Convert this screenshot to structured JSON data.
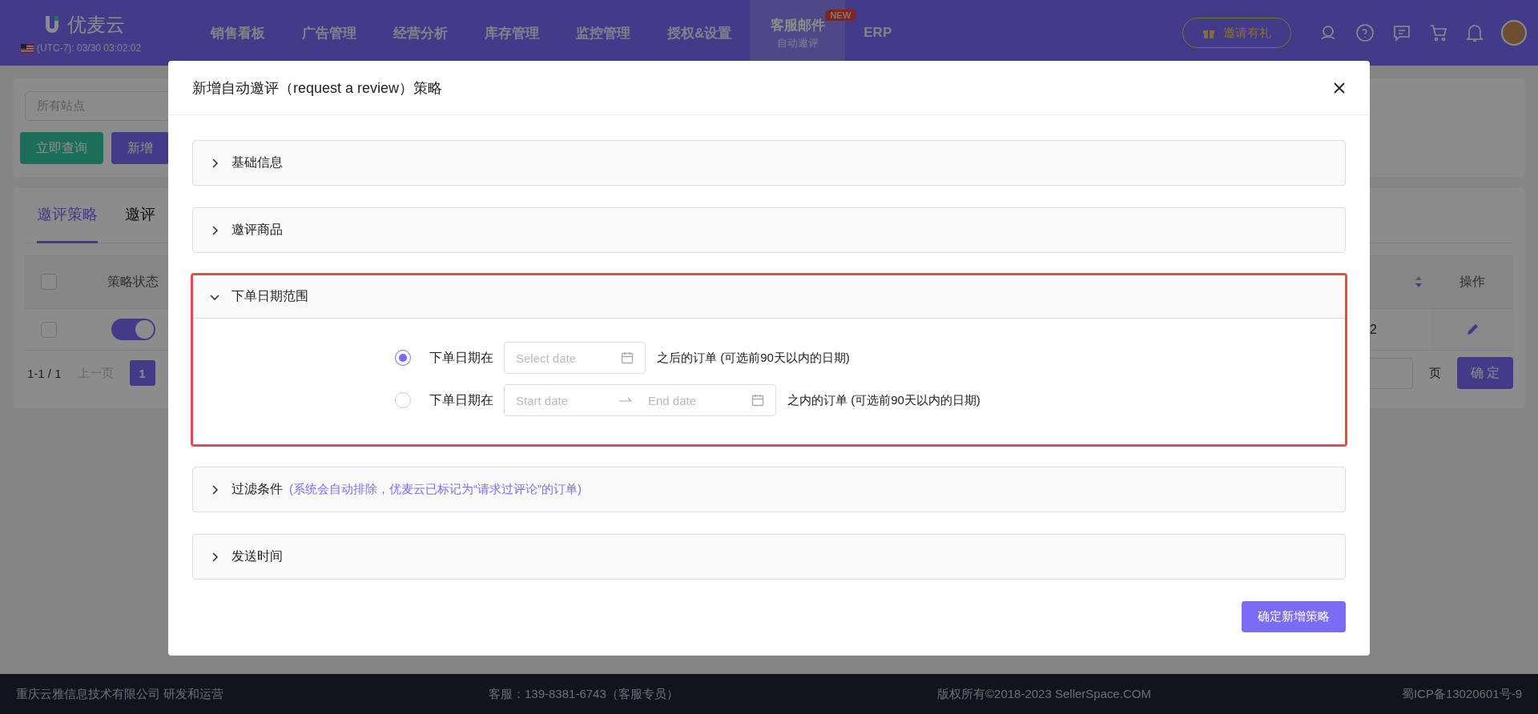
{
  "header": {
    "logo": "优麦云",
    "clock": "(UTC-7): 03/30 03:02:02",
    "nav": [
      {
        "label": "销售看板",
        "selected": false
      },
      {
        "label": "广告管理",
        "selected": false
      },
      {
        "label": "经营分析",
        "selected": false
      },
      {
        "label": "库存管理",
        "selected": false
      },
      {
        "label": "监控管理",
        "selected": false
      },
      {
        "label": "授权&设置",
        "selected": false
      },
      {
        "label": "客服邮件",
        "selected": true,
        "subtitle": "自动邀评",
        "badge": "NEW"
      },
      {
        "label": "ERP",
        "selected": false
      }
    ],
    "invite_button": "邀请有礼"
  },
  "page": {
    "site_select": {
      "placeholder": "所有站点"
    },
    "buttons": [
      {
        "label": "立即查询",
        "kind": "query"
      },
      {
        "label": "新增",
        "kind": "add"
      }
    ],
    "tabs": [
      {
        "label": "邀评策略",
        "selected": true
      },
      {
        "label": "邀评",
        "selected": false
      }
    ],
    "table": {
      "columns": [
        "策略状态",
        "操作"
      ],
      "header_checked": false,
      "rows": [
        {
          "checked": false,
          "on": true,
          "column_4": "2"
        }
      ]
    },
    "pagination": {
      "range": "1-1 / 1",
      "prev": "上一页",
      "pages": [
        {
          "label": "1",
          "selected": true
        }
      ],
      "page_unit": "页",
      "go_button": "确 定"
    }
  },
  "modal": {
    "title": "新增自动邀评（request a review）策略",
    "panels": [
      {
        "title": "基础信息",
        "expanded": false,
        "highlighted": false
      },
      {
        "title": "邀评商品",
        "expanded": false,
        "highlighted": false
      },
      {
        "title": "下单日期范围",
        "expanded": true,
        "highlighted": true,
        "options": [
          {
            "kind": "single",
            "selected": true,
            "label": "下单日期在",
            "placeholder": "Select date",
            "suffix": "之后的订单 (可选前90天以内的日期)"
          },
          {
            "kind": "range",
            "selected": false,
            "label": "下单日期在",
            "start_placeholder": "Start date",
            "end_placeholder": "End date",
            "suffix": "之内的订单 (可选前90天以内的日期)"
          }
        ]
      },
      {
        "title": "过滤条件",
        "note": "(系统会自动排除，优麦云已标记为“请求过评论”的订单)",
        "expanded": false,
        "highlighted": false
      },
      {
        "title": "发送时间",
        "expanded": false,
        "highlighted": false
      }
    ],
    "submit": "确定新增策略"
  },
  "footer": [
    "重庆云雅信息技术有限公司 研发和运营",
    "客服：139-8381-6743（客服专员）",
    "版权所有©2018-2023 SellerSpace.COM",
    "蜀ICP备13020601号-9"
  ]
}
